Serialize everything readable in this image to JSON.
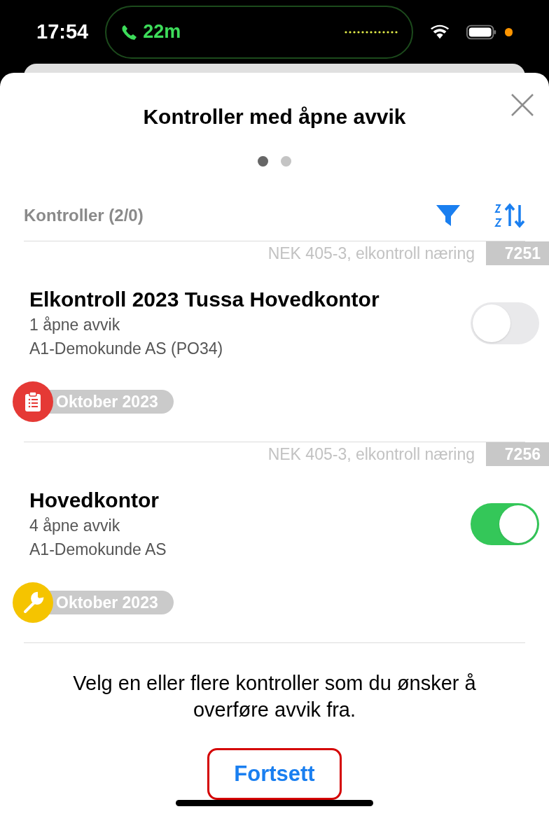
{
  "status_bar": {
    "time": "17:54",
    "call_duration": "22m"
  },
  "sheet": {
    "title": "Kontroller med åpne avvik",
    "pages": [
      {
        "selected": true
      },
      {
        "selected": false
      }
    ]
  },
  "list_header": {
    "label": "Kontroller (2/0)"
  },
  "items": [
    {
      "standard": "NEK 405-3, elkontroll næring",
      "number": "7251",
      "title": "Elkontroll 2023 Tussa Hovedkontor",
      "deviations": "1 åpne avvik",
      "customer": "A1-Demokunde AS (PO34)",
      "on": false,
      "kind": "clipboard",
      "color": "#e53935",
      "date": "Oktober 2023"
    },
    {
      "standard": "NEK 405-3, elkontroll næring",
      "number": "7256",
      "title": "Hovedkontor",
      "deviations": "4 åpne avvik",
      "customer": "A1-Demokunde AS",
      "on": true,
      "kind": "wrench",
      "color": "#f5c400",
      "date": "Oktober 2023"
    }
  ],
  "footer": {
    "message": "Velg en eller flere kontroller som du ønsker å overføre avvik fra.",
    "button": "Fortsett"
  }
}
